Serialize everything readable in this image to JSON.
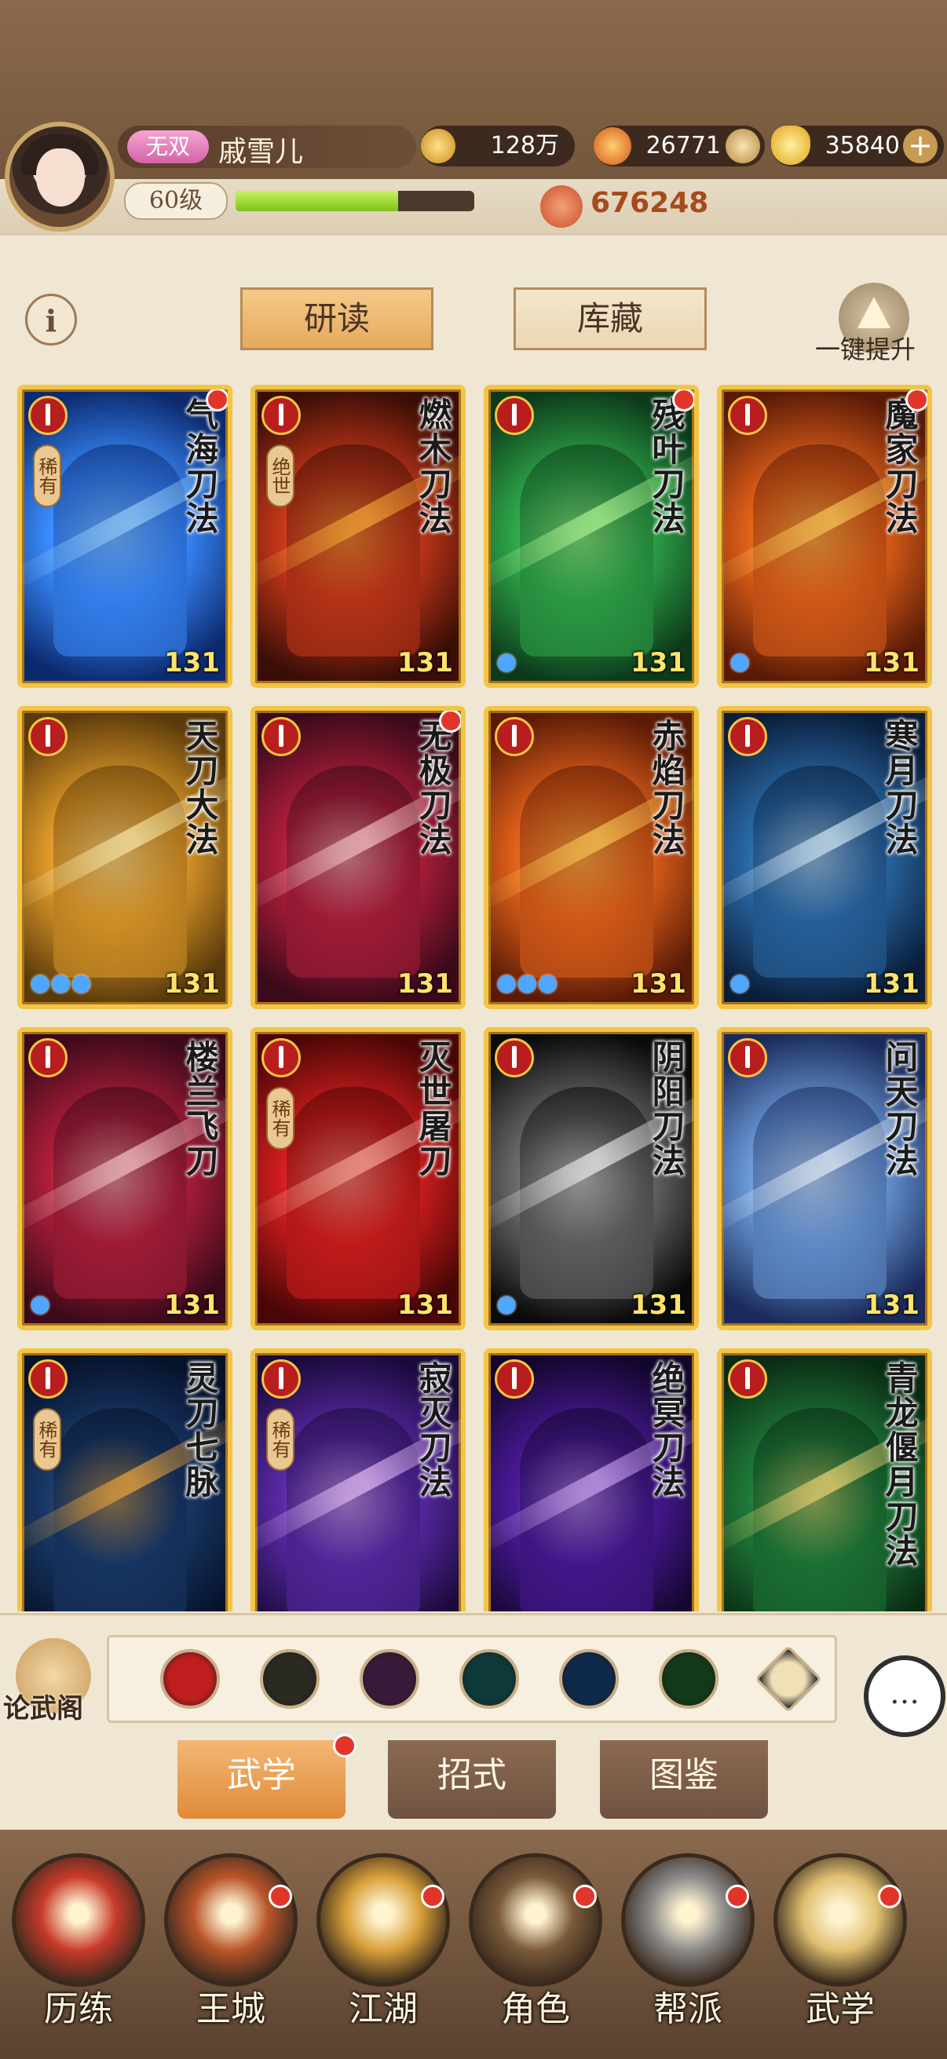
{
  "player": {
    "vip_badge": "无双",
    "name": "戚雪儿",
    "level": "60级",
    "xp_fraction": 0.68,
    "copper": "128万",
    "fire_resource": "26771",
    "gold_ingot": "35840",
    "power": "676248"
  },
  "tabs": {
    "read": "研读",
    "collection": "库藏"
  },
  "upgrade_all_label": "一键提升",
  "cards": [
    {
      "name": "气海刀法",
      "rarity": "稀有",
      "level": "131",
      "drops": "",
      "dot": true,
      "palette": "blue"
    },
    {
      "name": "燃木刀法",
      "rarity": "绝世",
      "level": "131",
      "drops": "",
      "dot": false,
      "palette": "fire"
    },
    {
      "name": "残叶刀法",
      "rarity": "",
      "level": "131",
      "drops": "●",
      "dot": true,
      "palette": "green"
    },
    {
      "name": "魔家刀法",
      "rarity": "",
      "level": "131",
      "drops": "●",
      "dot": true,
      "palette": "orange"
    },
    {
      "name": "天刀大法",
      "rarity": "",
      "level": "131",
      "drops": "●●●",
      "dot": false,
      "palette": "gold"
    },
    {
      "name": "无极刀法",
      "rarity": "",
      "level": "131",
      "drops": "",
      "dot": true,
      "palette": "crimson"
    },
    {
      "name": "赤焰刀法",
      "rarity": "",
      "level": "131",
      "drops": "●●●",
      "dot": false,
      "palette": "orange"
    },
    {
      "name": "寒月刀法",
      "rarity": "",
      "level": "131",
      "drops": "●",
      "dot": false,
      "palette": "ice"
    },
    {
      "name": "楼兰飞刀",
      "rarity": "",
      "level": "131",
      "drops": "●",
      "dot": false,
      "palette": "crimson"
    },
    {
      "name": "灭世屠刀",
      "rarity": "稀有",
      "level": "131",
      "drops": "",
      "dot": false,
      "palette": "red"
    },
    {
      "name": "阴阳刀法",
      "rarity": "",
      "level": "131",
      "drops": "●",
      "dot": false,
      "palette": "mono"
    },
    {
      "name": "问天刀法",
      "rarity": "",
      "level": "131",
      "drops": "",
      "dot": false,
      "palette": "sky"
    },
    {
      "name": "灵刀七脉",
      "rarity": "稀有",
      "level": "",
      "drops": "",
      "dot": false,
      "palette": "night"
    },
    {
      "name": "寂灭刀法",
      "rarity": "稀有",
      "level": "",
      "drops": "",
      "dot": false,
      "palette": "violet"
    },
    {
      "name": "绝冥刀法",
      "rarity": "",
      "level": "",
      "drops": "",
      "dot": false,
      "palette": "purple"
    },
    {
      "name": "青龙偃月刀法",
      "rarity": "",
      "level": "",
      "drops": "",
      "dot": false,
      "palette": "jade"
    }
  ],
  "filter": {
    "forum_label": "论武阁",
    "icons": [
      "saber-icon",
      "blade-black-icon",
      "claw-purple-icon",
      "fan-teal-icon",
      "yinyang-icon",
      "spiral-green-icon",
      "all-up-icon"
    ],
    "chat_glyph": "…"
  },
  "subtabs": {
    "martial": "武学",
    "moves": "招式",
    "codex": "图鉴"
  },
  "nav": [
    {
      "label": "历练",
      "dot": false
    },
    {
      "label": "王城",
      "dot": true
    },
    {
      "label": "江湖",
      "dot": true
    },
    {
      "label": "角色",
      "dot": true
    },
    {
      "label": "帮派",
      "dot": true
    },
    {
      "label": "武学",
      "dot": true
    }
  ],
  "colors": {
    "accent_gold": "#f3c544",
    "alert_red": "#e2352a",
    "level_yellow": "#ffe36b"
  }
}
